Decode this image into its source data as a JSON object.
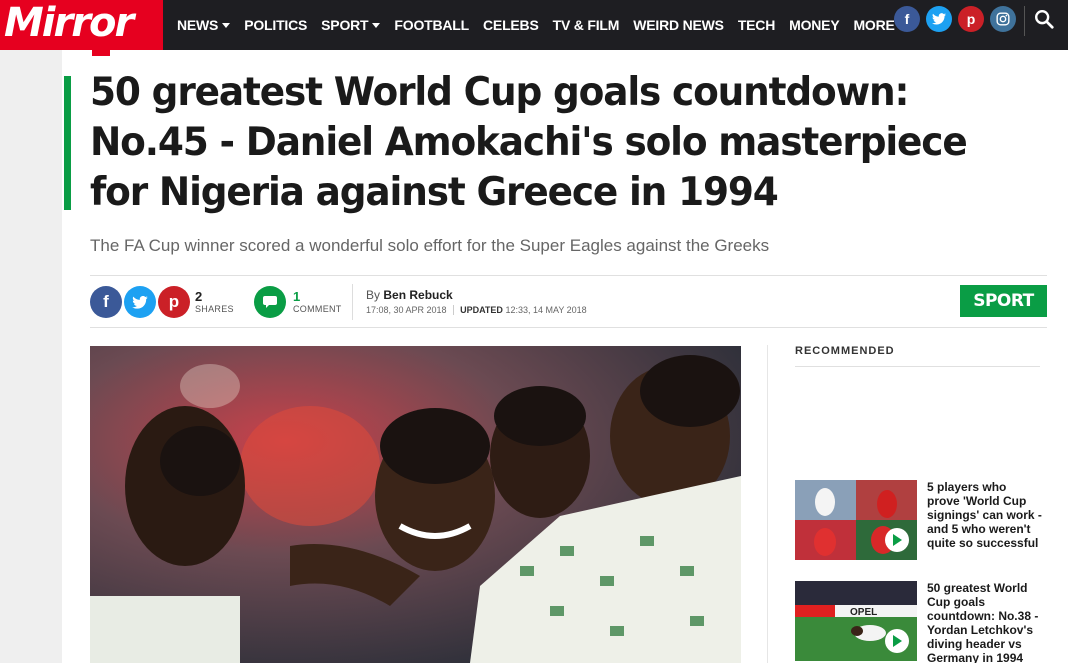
{
  "brand": {
    "logo": "Mirror",
    "accent": "#e6001f",
    "sport_green": "#0a9d45"
  },
  "nav": {
    "items": [
      {
        "label": "NEWS",
        "dropdown": true
      },
      {
        "label": "POLITICS",
        "dropdown": false
      },
      {
        "label": "SPORT",
        "dropdown": true
      },
      {
        "label": "FOOTBALL",
        "dropdown": false
      },
      {
        "label": "CELEBS",
        "dropdown": false
      },
      {
        "label": "TV & FILM",
        "dropdown": false
      },
      {
        "label": "WEIRD NEWS",
        "dropdown": false
      },
      {
        "label": "TECH",
        "dropdown": false
      },
      {
        "label": "MONEY",
        "dropdown": false
      },
      {
        "label": "MORE",
        "dropdown": true
      }
    ],
    "social": [
      "facebook-icon",
      "twitter-icon",
      "pinterest-icon",
      "instagram-icon"
    ],
    "search_icon": "search-icon"
  },
  "article": {
    "headline": "50 greatest World Cup goals countdown: No.45 - Daniel Amokachi's solo masterpiece for Nigeria against Greece in 1994",
    "subheadline": "The FA Cup winner scored a wonderful solo effort for the Super Eagles against the Greeks",
    "shares": {
      "count": "2",
      "label": "SHARES"
    },
    "comments": {
      "count": "1",
      "label": "COMMENT"
    },
    "byline": {
      "prefix": "By",
      "author": "Ben Rebuck"
    },
    "published": "17:08, 30 APR 2018",
    "updated_label": "UPDATED",
    "updated": "12:33, 14 MAY 2018",
    "section_button": "SPORT"
  },
  "sidebar": {
    "title": "RECOMMENDED",
    "items": [
      {
        "text": "5 players who prove 'World Cup signings' can work - and 5 who weren't quite so successful",
        "has_video": true
      },
      {
        "text": "50 greatest World Cup goals countdown: No.38 - Yordan Letchkov's diving header vs Germany in 1994",
        "has_video": true
      }
    ]
  }
}
